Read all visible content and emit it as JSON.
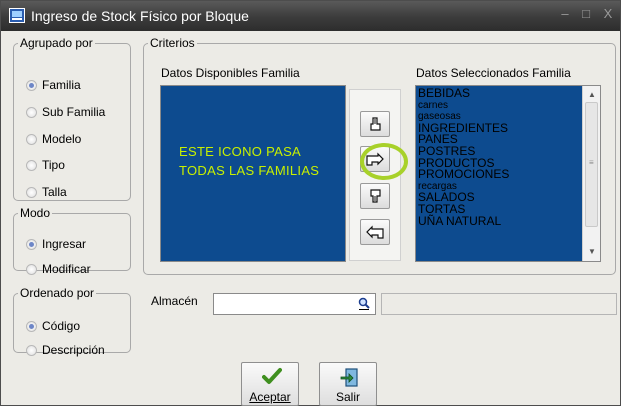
{
  "window": {
    "title": "Ingreso de Stock Físico por Bloque",
    "min_glyph": "–",
    "max_glyph": "□",
    "close_glyph": "X"
  },
  "agrupado": {
    "legend": "Agrupado por",
    "options": [
      "Familia",
      "Sub Familia",
      "Modelo",
      "Tipo",
      "Talla"
    ],
    "selected": "Familia"
  },
  "modo": {
    "legend": "Modo",
    "options": [
      "Ingresar",
      "Modificar"
    ],
    "selected": "Ingresar"
  },
  "ordenado": {
    "legend": "Ordenado por",
    "options": [
      "Código",
      "Descripción"
    ],
    "selected": "Código"
  },
  "criterios": {
    "legend": "Criterios",
    "available_label": "Datos Disponibles Familia",
    "selected_label": "Datos Seleccionados Familia",
    "annotation": [
      "ESTE ICONO PASA",
      "TODAS LAS FAMILIAS"
    ],
    "selected_items": [
      "BEBIDAS",
      "carnes",
      "gaseosas",
      "INGREDIENTES",
      "PANES",
      "POSTRES",
      "PRODUCTOS",
      "PROMOCIONES",
      "recargas",
      "SALADOS",
      "TORTAS",
      "UÑA NATURAL"
    ],
    "transfer_buttons": [
      "move-one-right-icon",
      "move-all-right-icon",
      "move-one-left-icon",
      "move-all-left-icon"
    ]
  },
  "almacen": {
    "label": "Almacén",
    "value": "",
    "description": ""
  },
  "actions": {
    "accept_label": "Aceptar",
    "exit_label": "Salir"
  },
  "colors": {
    "list_background": "#0d4b8f",
    "annotation_text": "#c8f000",
    "highlight_ring": "#a8d12a",
    "titlebar": "#3b3b3b"
  }
}
